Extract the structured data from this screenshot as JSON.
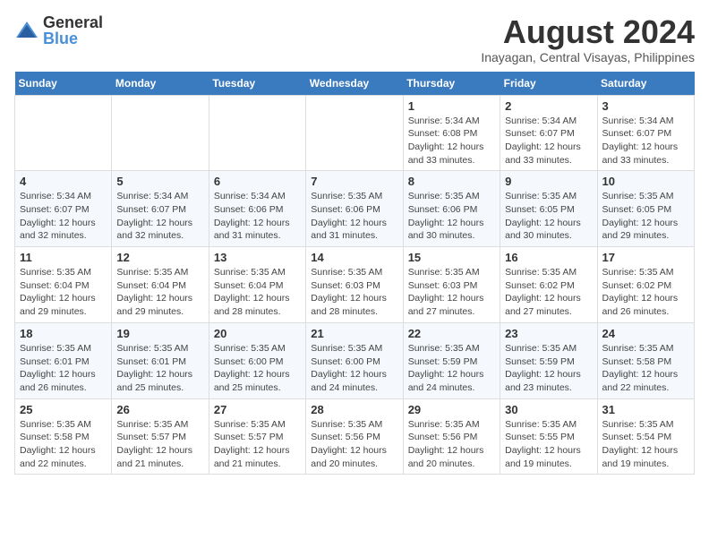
{
  "header": {
    "logo_general": "General",
    "logo_blue": "Blue",
    "title": "August 2024",
    "subtitle": "Inayagan, Central Visayas, Philippines"
  },
  "weekdays": [
    "Sunday",
    "Monday",
    "Tuesday",
    "Wednesday",
    "Thursday",
    "Friday",
    "Saturday"
  ],
  "weeks": [
    [
      {
        "day": "",
        "info": ""
      },
      {
        "day": "",
        "info": ""
      },
      {
        "day": "",
        "info": ""
      },
      {
        "day": "",
        "info": ""
      },
      {
        "day": "1",
        "info": "Sunrise: 5:34 AM\nSunset: 6:08 PM\nDaylight: 12 hours\nand 33 minutes."
      },
      {
        "day": "2",
        "info": "Sunrise: 5:34 AM\nSunset: 6:07 PM\nDaylight: 12 hours\nand 33 minutes."
      },
      {
        "day": "3",
        "info": "Sunrise: 5:34 AM\nSunset: 6:07 PM\nDaylight: 12 hours\nand 33 minutes."
      }
    ],
    [
      {
        "day": "4",
        "info": "Sunrise: 5:34 AM\nSunset: 6:07 PM\nDaylight: 12 hours\nand 32 minutes."
      },
      {
        "day": "5",
        "info": "Sunrise: 5:34 AM\nSunset: 6:07 PM\nDaylight: 12 hours\nand 32 minutes."
      },
      {
        "day": "6",
        "info": "Sunrise: 5:34 AM\nSunset: 6:06 PM\nDaylight: 12 hours\nand 31 minutes."
      },
      {
        "day": "7",
        "info": "Sunrise: 5:35 AM\nSunset: 6:06 PM\nDaylight: 12 hours\nand 31 minutes."
      },
      {
        "day": "8",
        "info": "Sunrise: 5:35 AM\nSunset: 6:06 PM\nDaylight: 12 hours\nand 30 minutes."
      },
      {
        "day": "9",
        "info": "Sunrise: 5:35 AM\nSunset: 6:05 PM\nDaylight: 12 hours\nand 30 minutes."
      },
      {
        "day": "10",
        "info": "Sunrise: 5:35 AM\nSunset: 6:05 PM\nDaylight: 12 hours\nand 29 minutes."
      }
    ],
    [
      {
        "day": "11",
        "info": "Sunrise: 5:35 AM\nSunset: 6:04 PM\nDaylight: 12 hours\nand 29 minutes."
      },
      {
        "day": "12",
        "info": "Sunrise: 5:35 AM\nSunset: 6:04 PM\nDaylight: 12 hours\nand 29 minutes."
      },
      {
        "day": "13",
        "info": "Sunrise: 5:35 AM\nSunset: 6:04 PM\nDaylight: 12 hours\nand 28 minutes."
      },
      {
        "day": "14",
        "info": "Sunrise: 5:35 AM\nSunset: 6:03 PM\nDaylight: 12 hours\nand 28 minutes."
      },
      {
        "day": "15",
        "info": "Sunrise: 5:35 AM\nSunset: 6:03 PM\nDaylight: 12 hours\nand 27 minutes."
      },
      {
        "day": "16",
        "info": "Sunrise: 5:35 AM\nSunset: 6:02 PM\nDaylight: 12 hours\nand 27 minutes."
      },
      {
        "day": "17",
        "info": "Sunrise: 5:35 AM\nSunset: 6:02 PM\nDaylight: 12 hours\nand 26 minutes."
      }
    ],
    [
      {
        "day": "18",
        "info": "Sunrise: 5:35 AM\nSunset: 6:01 PM\nDaylight: 12 hours\nand 26 minutes."
      },
      {
        "day": "19",
        "info": "Sunrise: 5:35 AM\nSunset: 6:01 PM\nDaylight: 12 hours\nand 25 minutes."
      },
      {
        "day": "20",
        "info": "Sunrise: 5:35 AM\nSunset: 6:00 PM\nDaylight: 12 hours\nand 25 minutes."
      },
      {
        "day": "21",
        "info": "Sunrise: 5:35 AM\nSunset: 6:00 PM\nDaylight: 12 hours\nand 24 minutes."
      },
      {
        "day": "22",
        "info": "Sunrise: 5:35 AM\nSunset: 5:59 PM\nDaylight: 12 hours\nand 24 minutes."
      },
      {
        "day": "23",
        "info": "Sunrise: 5:35 AM\nSunset: 5:59 PM\nDaylight: 12 hours\nand 23 minutes."
      },
      {
        "day": "24",
        "info": "Sunrise: 5:35 AM\nSunset: 5:58 PM\nDaylight: 12 hours\nand 22 minutes."
      }
    ],
    [
      {
        "day": "25",
        "info": "Sunrise: 5:35 AM\nSunset: 5:58 PM\nDaylight: 12 hours\nand 22 minutes."
      },
      {
        "day": "26",
        "info": "Sunrise: 5:35 AM\nSunset: 5:57 PM\nDaylight: 12 hours\nand 21 minutes."
      },
      {
        "day": "27",
        "info": "Sunrise: 5:35 AM\nSunset: 5:57 PM\nDaylight: 12 hours\nand 21 minutes."
      },
      {
        "day": "28",
        "info": "Sunrise: 5:35 AM\nSunset: 5:56 PM\nDaylight: 12 hours\nand 20 minutes."
      },
      {
        "day": "29",
        "info": "Sunrise: 5:35 AM\nSunset: 5:56 PM\nDaylight: 12 hours\nand 20 minutes."
      },
      {
        "day": "30",
        "info": "Sunrise: 5:35 AM\nSunset: 5:55 PM\nDaylight: 12 hours\nand 19 minutes."
      },
      {
        "day": "31",
        "info": "Sunrise: 5:35 AM\nSunset: 5:54 PM\nDaylight: 12 hours\nand 19 minutes."
      }
    ]
  ]
}
